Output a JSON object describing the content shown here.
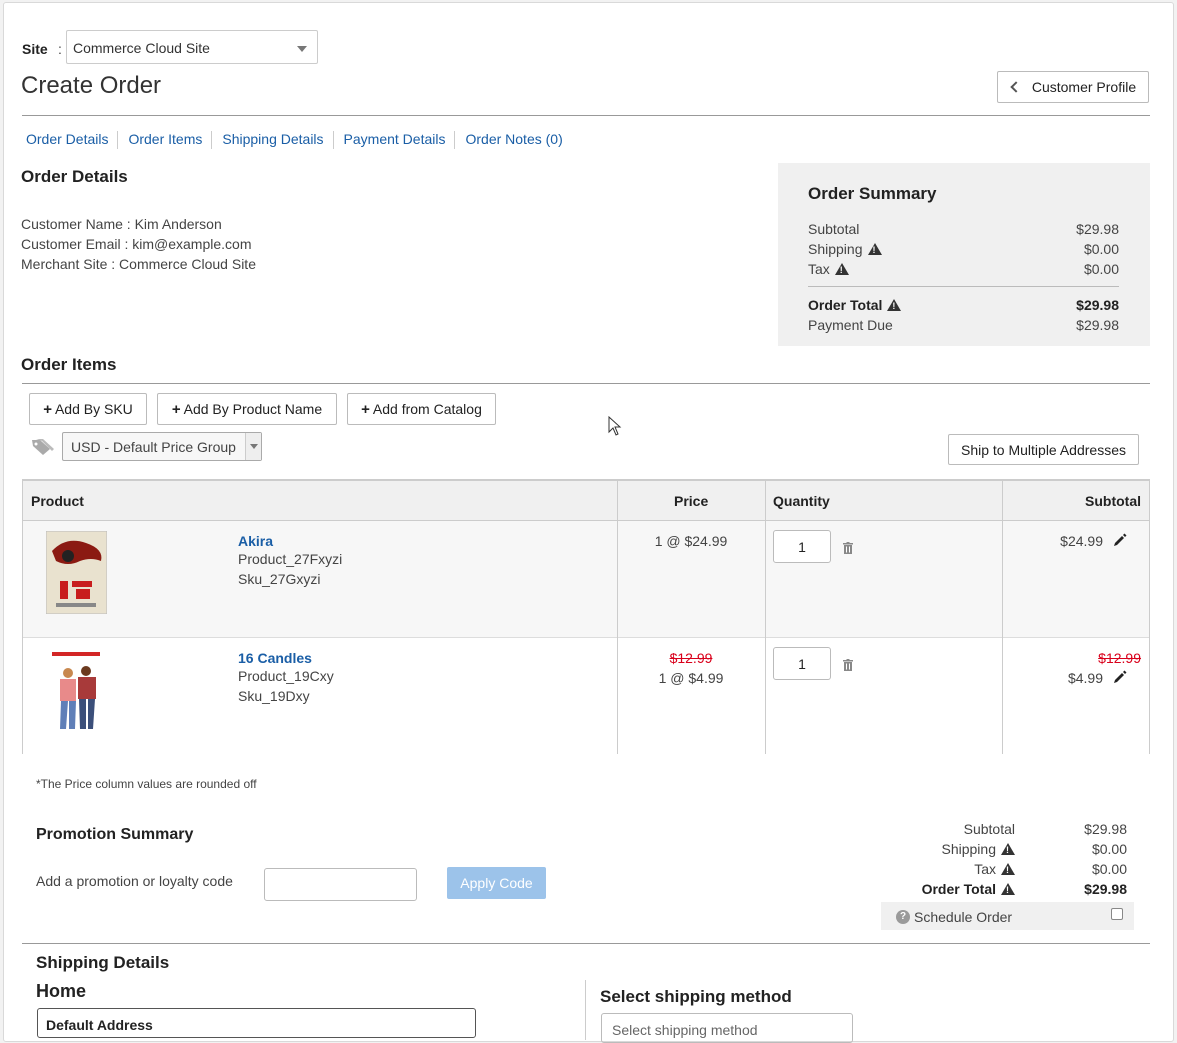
{
  "site": {
    "label": "Site",
    "colon": ":",
    "selected": "Commerce Cloud Site"
  },
  "header": {
    "title": "Create Order",
    "customer_profile_label": "Customer Profile"
  },
  "tabs": [
    "Order Details",
    "Order Items",
    "Shipping Details",
    "Payment Details",
    "Order Notes (0)"
  ],
  "order_details": {
    "heading": "Order Details",
    "customer_name": "Customer Name : Kim Anderson",
    "customer_email": "Customer Email : kim@example.com",
    "merchant_site": "Merchant Site : Commerce Cloud Site"
  },
  "order_summary": {
    "title": "Order Summary",
    "subtotal_label": "Subtotal",
    "subtotal": "$29.98",
    "shipping_label": "Shipping",
    "shipping": "$0.00",
    "tax_label": "Tax",
    "tax": "$0.00",
    "total_label": "Order Total",
    "total": "$29.98",
    "due_label": "Payment Due",
    "due": "$29.98"
  },
  "order_items": {
    "heading": "Order Items",
    "add_by_sku": "Add By SKU",
    "add_by_name": "Add By Product Name",
    "add_from_catalog": "Add from Catalog",
    "price_group": "USD - Default Price Group",
    "ship_multiple": "Ship to Multiple Addresses",
    "columns": {
      "product": "Product",
      "price": "Price",
      "quantity": "Quantity",
      "subtotal": "Subtotal"
    },
    "rows": [
      {
        "name": "Akira",
        "product_id": "Product_27Fxyzi",
        "sku": "Sku_27Gxyzi",
        "original_price": "",
        "price": "1 @ $24.99",
        "qty": "1",
        "original_subtotal": "",
        "subtotal": "$24.99"
      },
      {
        "name": "16 Candles",
        "product_id": "Product_19Cxy",
        "sku": "Sku_19Dxy",
        "original_price": "$12.99",
        "price": "1 @ $4.99",
        "qty": "1",
        "original_subtotal": "$12.99",
        "subtotal": "$4.99"
      }
    ],
    "footnote": "*The Price column values are rounded off"
  },
  "promotion": {
    "heading": "Promotion Summary",
    "label": "Add a promotion or loyalty code",
    "input_value": "",
    "apply_label": "Apply Code"
  },
  "totals": {
    "subtotal_label": "Subtotal",
    "subtotal": "$29.98",
    "shipping_label": "Shipping",
    "shipping": "$0.00",
    "tax_label": "Tax",
    "tax": "$0.00",
    "total_label": "Order Total",
    "total": "$29.98",
    "schedule_label": "Schedule Order"
  },
  "shipping": {
    "heading": "Shipping Details",
    "address_title": "Home",
    "address_select": "Default Address",
    "method_heading": "Select shipping method",
    "method_select": "Select shipping method"
  },
  "colors": {
    "link": "#1a5ea6",
    "strike": "#d9001b",
    "apply_button": "#9cc3ea",
    "summary_bg": "#f0f0f0"
  }
}
